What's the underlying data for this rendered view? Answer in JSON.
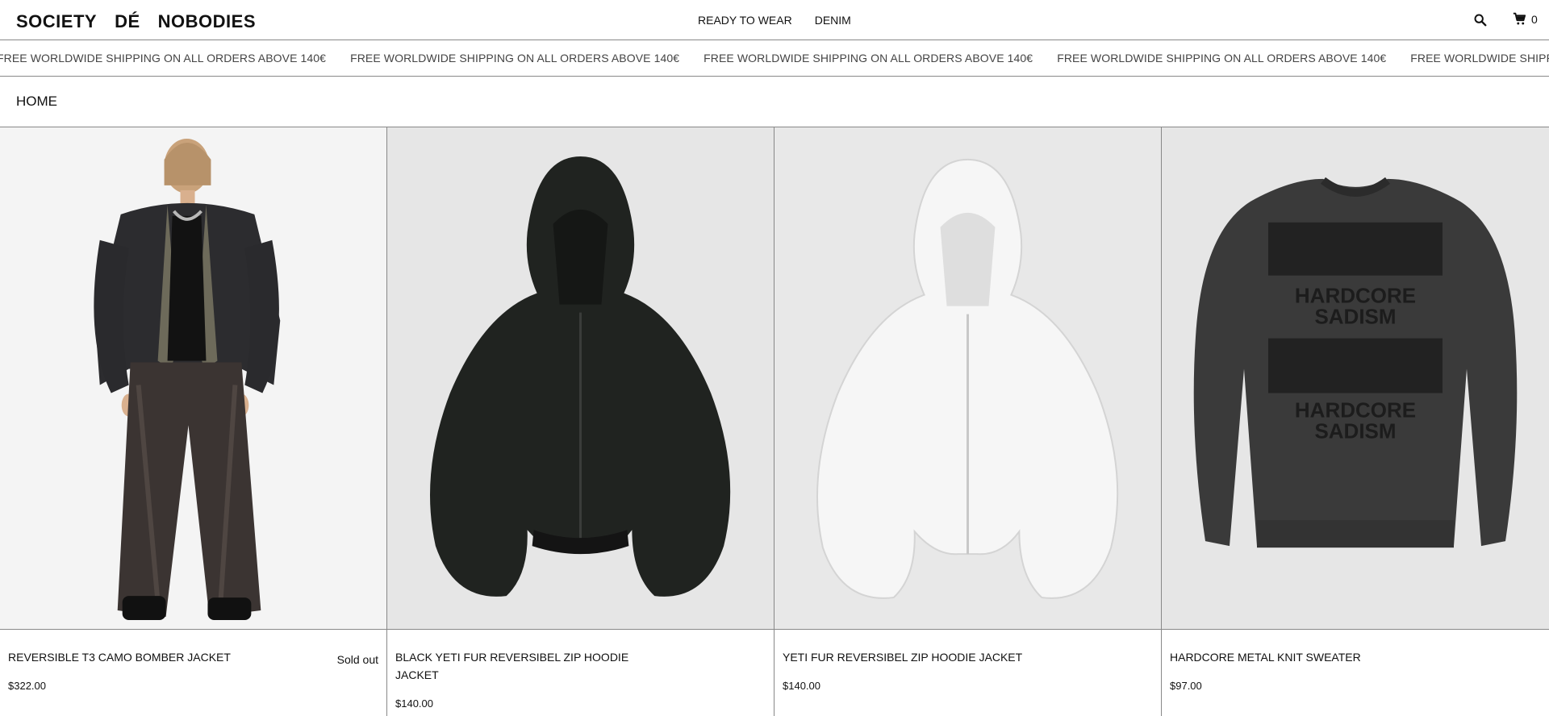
{
  "header": {
    "logo_words": [
      "SOCIETY",
      "DÉ",
      "NOBODIES"
    ],
    "nav": [
      "READY TO WEAR",
      "DENIM"
    ],
    "cart_count": "0",
    "icons": {
      "search": "search-icon",
      "cart": "cart-icon"
    }
  },
  "announcement": {
    "text": "FREE WORLDWIDE SHIPPING ON ALL ORDERS ABOVE 140€"
  },
  "breadcrumb": "HOME",
  "products": [
    {
      "title": "REVERSIBLE T3 CAMO BOMBER JACKET",
      "price": "$322.00",
      "badge": "Sold out"
    },
    {
      "title": "BLACK YETI FUR REVERSIBEL ZIP HOODIE JACKET",
      "price": "$140.00",
      "badge": ""
    },
    {
      "title": "YETI FUR REVERSIBEL ZIP HOODIE JACKET",
      "price": "$140.00",
      "badge": ""
    },
    {
      "title": "HARDCORE METAL KNIT SWEATER",
      "price": "$97.00",
      "badge": ""
    }
  ],
  "sweater_print": [
    "HARDCORE",
    "SADISM",
    "HARDCORE",
    "SADISM"
  ],
  "colors": {
    "image_bg": "#e9e9e9",
    "border": "#888888",
    "text": "#111111"
  }
}
